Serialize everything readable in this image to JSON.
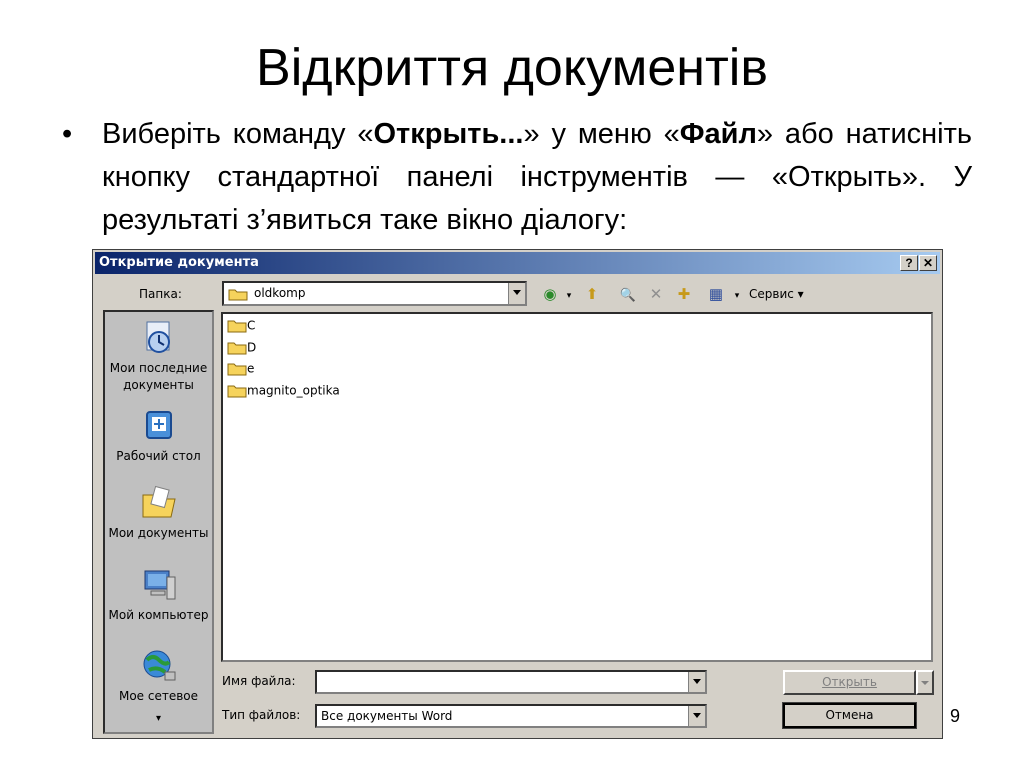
{
  "slide": {
    "title": "Відкриття документів",
    "bullet_marker": "•",
    "bullet_parts": [
      "Виберіть команду «",
      "Открыть...",
      "» у меню «",
      "Файл",
      "» або натисніть кнопку стандартної панелі інструментів — «Открыть». У результаті з’явиться таке вікно діалогу:"
    ],
    "page_number": "9"
  },
  "dialog": {
    "title": "Открытие документа",
    "help_label": "?",
    "close_label": "✕",
    "folder_label": "Папка:",
    "folder_value": "oldkomp",
    "toolbar": {
      "back_glyph": "◉",
      "back_dropdown": "▾",
      "up_glyph": "⬆",
      "search_glyph": "🔍",
      "delete_glyph": "✕",
      "new_folder_glyph": "✚",
      "views_glyph": "▦",
      "views_dropdown": "▾",
      "tools_label": "Сервис ▾"
    },
    "places": [
      {
        "label": "Мои последние документы",
        "icon": "recent-documents-icon"
      },
      {
        "label": "Рабочий стол",
        "icon": "desktop-icon"
      },
      {
        "label": "Мои документы",
        "icon": "my-documents-icon"
      },
      {
        "label": "Мой компьютер",
        "icon": "my-computer-icon"
      },
      {
        "label": "Мое сетевое",
        "icon": "network-icon"
      }
    ],
    "places_more": "▾",
    "files": [
      "C",
      "D",
      "e",
      "magnito_optika"
    ],
    "filename_label": "Имя файла:",
    "filename_value": "",
    "filetype_label": "Тип файлов:",
    "filetype_value": "Все документы Word",
    "open_label": "Открыть",
    "cancel_label": "Отмена"
  },
  "colors": {
    "titlebar_start": "#0a246a",
    "titlebar_end": "#a6caf0",
    "dialog_bg": "#d4d0c8",
    "folder_fill": "#f6d35c"
  }
}
